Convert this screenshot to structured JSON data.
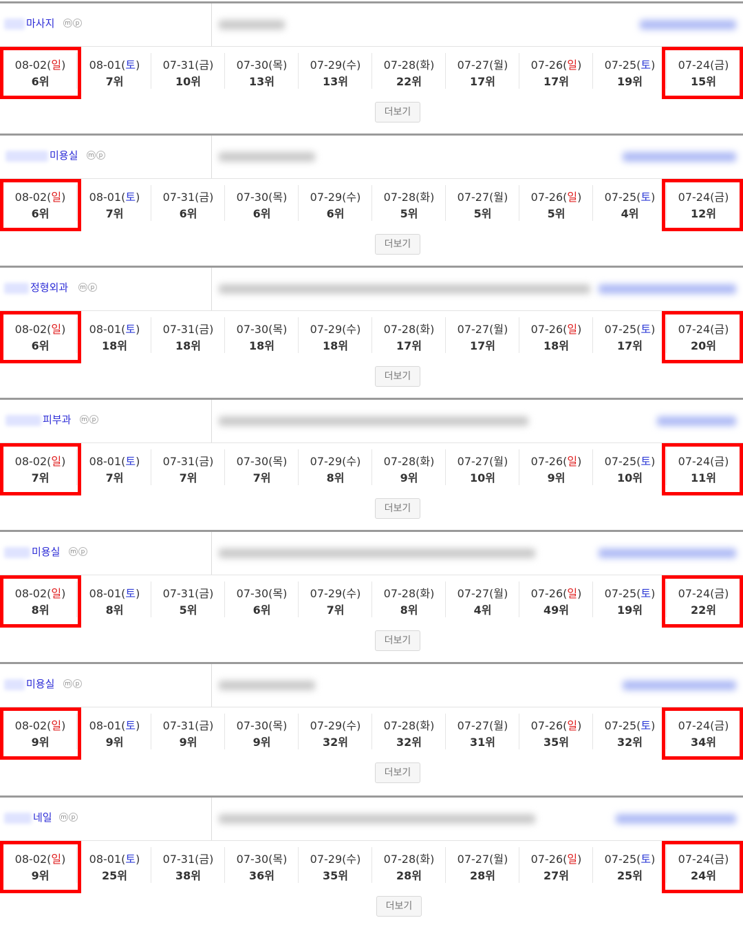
{
  "more_label": "더보기",
  "icons": {
    "mobile": "m",
    "pc": "p"
  },
  "colors": {
    "sunday": "#e02020",
    "saturday": "#2e3bd6",
    "highlight": "#ff0000",
    "keyword": "#2b2bd6"
  },
  "blocks": [
    {
      "keyword": "마사지",
      "days": [
        {
          "date": "08-02",
          "dow": "일",
          "rank": "6위"
        },
        {
          "date": "08-01",
          "dow": "토",
          "rank": "7위"
        },
        {
          "date": "07-31",
          "dow": "금",
          "rank": "10위"
        },
        {
          "date": "07-30",
          "dow": "목",
          "rank": "13위"
        },
        {
          "date": "07-29",
          "dow": "수",
          "rank": "13위"
        },
        {
          "date": "07-28",
          "dow": "화",
          "rank": "22위"
        },
        {
          "date": "07-27",
          "dow": "월",
          "rank": "17위"
        },
        {
          "date": "07-26",
          "dow": "일",
          "rank": "17위"
        },
        {
          "date": "07-25",
          "dow": "토",
          "rank": "19위"
        },
        {
          "date": "07-24",
          "dow": "금",
          "rank": "15위"
        }
      ]
    },
    {
      "keyword": "미용실",
      "days": [
        {
          "date": "08-02",
          "dow": "일",
          "rank": "6위"
        },
        {
          "date": "08-01",
          "dow": "토",
          "rank": "7위"
        },
        {
          "date": "07-31",
          "dow": "금",
          "rank": "6위"
        },
        {
          "date": "07-30",
          "dow": "목",
          "rank": "6위"
        },
        {
          "date": "07-29",
          "dow": "수",
          "rank": "6위"
        },
        {
          "date": "07-28",
          "dow": "화",
          "rank": "5위"
        },
        {
          "date": "07-27",
          "dow": "월",
          "rank": "5위"
        },
        {
          "date": "07-26",
          "dow": "일",
          "rank": "5위"
        },
        {
          "date": "07-25",
          "dow": "토",
          "rank": "4위"
        },
        {
          "date": "07-24",
          "dow": "금",
          "rank": "12위"
        }
      ]
    },
    {
      "keyword": "정형외과",
      "days": [
        {
          "date": "08-02",
          "dow": "일",
          "rank": "6위"
        },
        {
          "date": "08-01",
          "dow": "토",
          "rank": "18위"
        },
        {
          "date": "07-31",
          "dow": "금",
          "rank": "18위"
        },
        {
          "date": "07-30",
          "dow": "목",
          "rank": "18위"
        },
        {
          "date": "07-29",
          "dow": "수",
          "rank": "18위"
        },
        {
          "date": "07-28",
          "dow": "화",
          "rank": "17위"
        },
        {
          "date": "07-27",
          "dow": "월",
          "rank": "17위"
        },
        {
          "date": "07-26",
          "dow": "일",
          "rank": "18위"
        },
        {
          "date": "07-25",
          "dow": "토",
          "rank": "17위"
        },
        {
          "date": "07-24",
          "dow": "금",
          "rank": "20위"
        }
      ]
    },
    {
      "keyword": "피부과",
      "days": [
        {
          "date": "08-02",
          "dow": "일",
          "rank": "7위"
        },
        {
          "date": "08-01",
          "dow": "토",
          "rank": "7위"
        },
        {
          "date": "07-31",
          "dow": "금",
          "rank": "7위"
        },
        {
          "date": "07-30",
          "dow": "목",
          "rank": "7위"
        },
        {
          "date": "07-29",
          "dow": "수",
          "rank": "8위"
        },
        {
          "date": "07-28",
          "dow": "화",
          "rank": "9위"
        },
        {
          "date": "07-27",
          "dow": "월",
          "rank": "10위"
        },
        {
          "date": "07-26",
          "dow": "일",
          "rank": "9위"
        },
        {
          "date": "07-25",
          "dow": "토",
          "rank": "10위"
        },
        {
          "date": "07-24",
          "dow": "금",
          "rank": "11위"
        }
      ]
    },
    {
      "keyword": "미용실",
      "days": [
        {
          "date": "08-02",
          "dow": "일",
          "rank": "8위"
        },
        {
          "date": "08-01",
          "dow": "토",
          "rank": "8위"
        },
        {
          "date": "07-31",
          "dow": "금",
          "rank": "5위"
        },
        {
          "date": "07-30",
          "dow": "목",
          "rank": "6위"
        },
        {
          "date": "07-29",
          "dow": "수",
          "rank": "7위"
        },
        {
          "date": "07-28",
          "dow": "화",
          "rank": "8위"
        },
        {
          "date": "07-27",
          "dow": "월",
          "rank": "4위"
        },
        {
          "date": "07-26",
          "dow": "일",
          "rank": "49위"
        },
        {
          "date": "07-25",
          "dow": "토",
          "rank": "19위"
        },
        {
          "date": "07-24",
          "dow": "금",
          "rank": "22위"
        }
      ]
    },
    {
      "keyword": "미용실",
      "days": [
        {
          "date": "08-02",
          "dow": "일",
          "rank": "9위"
        },
        {
          "date": "08-01",
          "dow": "토",
          "rank": "9위"
        },
        {
          "date": "07-31",
          "dow": "금",
          "rank": "9위"
        },
        {
          "date": "07-30",
          "dow": "목",
          "rank": "9위"
        },
        {
          "date": "07-29",
          "dow": "수",
          "rank": "32위"
        },
        {
          "date": "07-28",
          "dow": "화",
          "rank": "32위"
        },
        {
          "date": "07-27",
          "dow": "월",
          "rank": "31위"
        },
        {
          "date": "07-26",
          "dow": "일",
          "rank": "35위"
        },
        {
          "date": "07-25",
          "dow": "토",
          "rank": "32위"
        },
        {
          "date": "07-24",
          "dow": "금",
          "rank": "34위"
        }
      ]
    },
    {
      "keyword": "네일",
      "days": [
        {
          "date": "08-02",
          "dow": "일",
          "rank": "9위"
        },
        {
          "date": "08-01",
          "dow": "토",
          "rank": "25위"
        },
        {
          "date": "07-31",
          "dow": "금",
          "rank": "38위"
        },
        {
          "date": "07-30",
          "dow": "목",
          "rank": "36위"
        },
        {
          "date": "07-29",
          "dow": "수",
          "rank": "35위"
        },
        {
          "date": "07-28",
          "dow": "화",
          "rank": "28위"
        },
        {
          "date": "07-27",
          "dow": "월",
          "rank": "28위"
        },
        {
          "date": "07-26",
          "dow": "일",
          "rank": "27위"
        },
        {
          "date": "07-25",
          "dow": "토",
          "rank": "25위"
        },
        {
          "date": "07-24",
          "dow": "금",
          "rank": "24위"
        }
      ]
    }
  ]
}
